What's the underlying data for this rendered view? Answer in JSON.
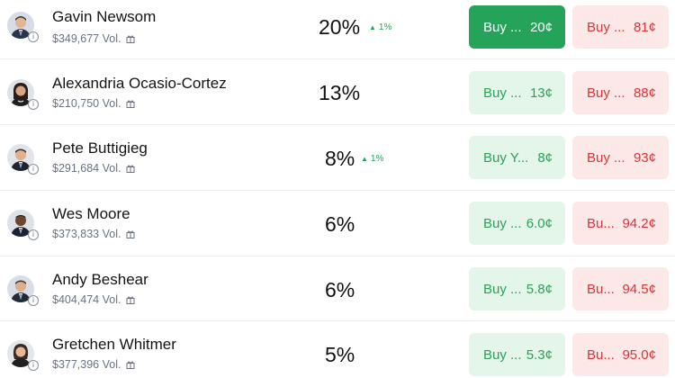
{
  "candidates": [
    {
      "name": "Gavin Newsom",
      "volume": "$349,677 Vol.",
      "percent": "20%",
      "delta": "1%",
      "yes_label": "Buy ...",
      "yes_price": "20¢",
      "no_label": "Buy ...",
      "no_price": "81¢",
      "yes_active": true
    },
    {
      "name": "Alexandria Ocasio-Cortez",
      "volume": "$210,750 Vol.",
      "percent": "13%",
      "delta": "",
      "yes_label": "Buy ...",
      "yes_price": "13¢",
      "no_label": "Buy ...",
      "no_price": "88¢",
      "yes_active": false
    },
    {
      "name": "Pete Buttigieg",
      "volume": "$291,684 Vol.",
      "percent": "8%",
      "delta": "1%",
      "yes_label": "Buy Y...",
      "yes_price": "8¢",
      "no_label": "Buy ...",
      "no_price": "93¢",
      "yes_active": false
    },
    {
      "name": "Wes Moore",
      "volume": "$373,833 Vol.",
      "percent": "6%",
      "delta": "",
      "yes_label": "Buy ...",
      "yes_price": "6.0¢",
      "no_label": "Bu...",
      "no_price": "94.2¢",
      "yes_active": false
    },
    {
      "name": "Andy Beshear",
      "volume": "$404,474 Vol.",
      "percent": "6%",
      "delta": "",
      "yes_label": "Buy ...",
      "yes_price": "5.8¢",
      "no_label": "Bu...",
      "no_price": "94.5¢",
      "yes_active": false
    },
    {
      "name": "Gretchen Whitmer",
      "volume": "$377,396 Vol.",
      "percent": "5%",
      "delta": "",
      "yes_label": "Buy ...",
      "yes_price": "5.3¢",
      "no_label": "Bu...",
      "no_price": "95.0¢",
      "yes_active": false
    }
  ],
  "colors": {
    "yes_bg": "#e4f5e9",
    "yes_text": "#2da05a",
    "yes_active_bg": "#26a35a",
    "no_bg": "#fde8e8",
    "no_text": "#d8353a",
    "delta_up": "#27a25a"
  },
  "icons": {
    "info": "info-icon",
    "gift": "gift-icon",
    "delta_up": "triangle-up-icon"
  }
}
